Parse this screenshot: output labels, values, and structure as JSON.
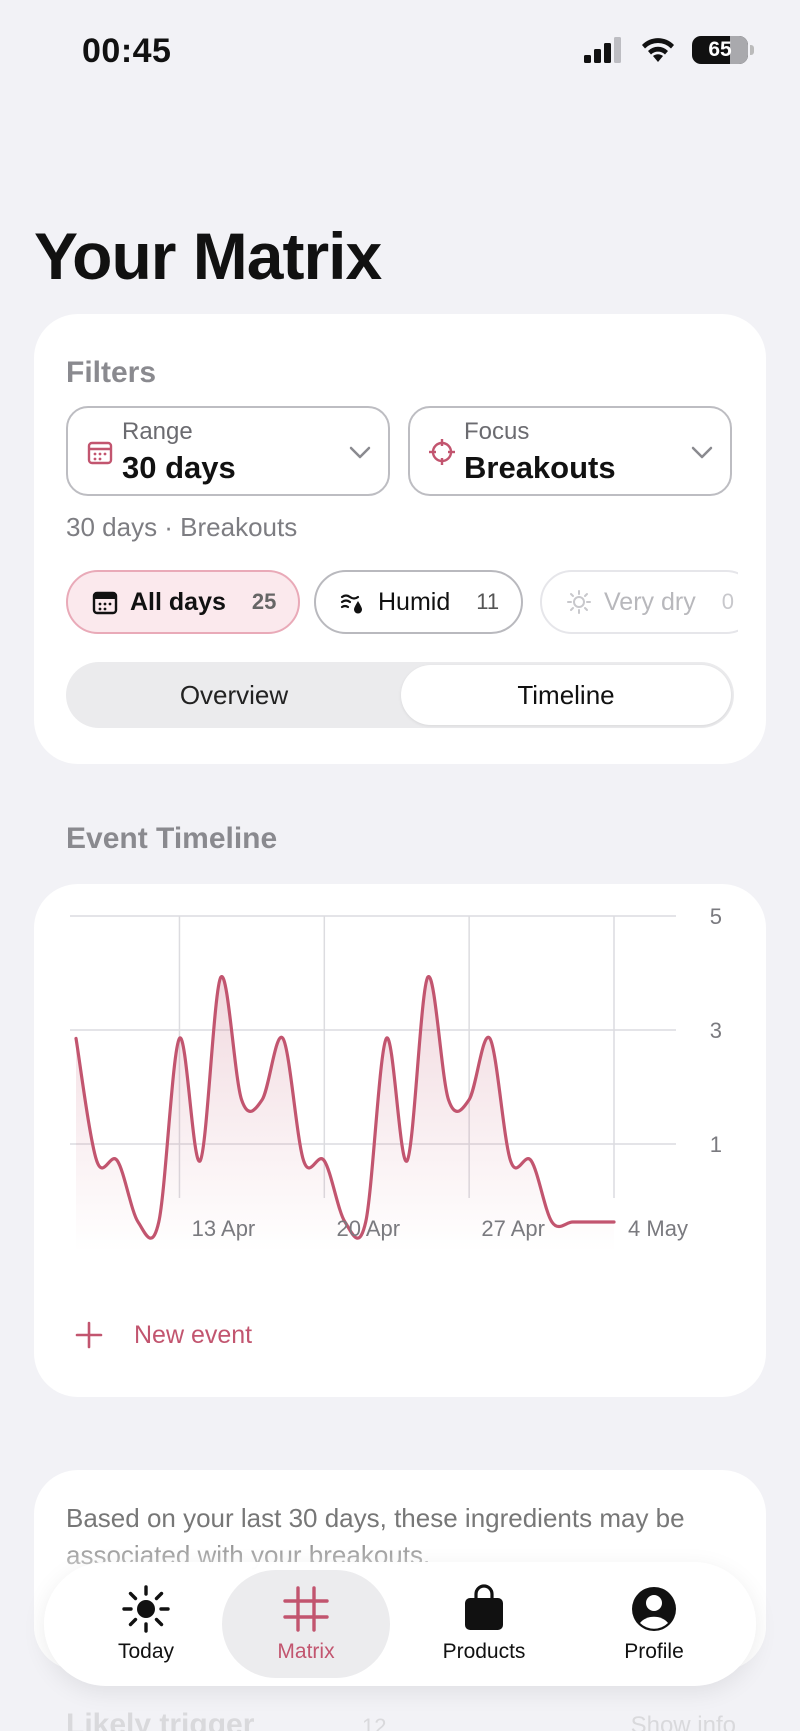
{
  "status": {
    "time": "00:45",
    "battery": "65"
  },
  "page": {
    "title": "Your Matrix"
  },
  "filters": {
    "section_label": "Filters",
    "range": {
      "label": "Range",
      "value": "30 days"
    },
    "focus": {
      "label": "Focus",
      "value": "Breakouts"
    },
    "summary": "30 days · Breakouts",
    "chips": [
      {
        "label": "All days",
        "count": "25",
        "icon": "calendar-icon"
      },
      {
        "label": "Humid",
        "count": "11",
        "icon": "humid-icon"
      },
      {
        "label": "Very dry",
        "count": "0",
        "icon": "sun-icon"
      }
    ],
    "segments": {
      "overview": "Overview",
      "timeline": "Timeline",
      "selected": "Timeline"
    }
  },
  "timeline": {
    "section_label": "Event Timeline",
    "new_event_label": "New event"
  },
  "chart_data": {
    "type": "area",
    "x": [
      "8 Apr",
      "9 Apr",
      "10 Apr",
      "11 Apr",
      "12 Apr",
      "13 Apr",
      "14 Apr",
      "15 Apr",
      "16 Apr",
      "17 Apr",
      "18 Apr",
      "19 Apr",
      "20 Apr",
      "21 Apr",
      "22 Apr",
      "23 Apr",
      "24 Apr",
      "25 Apr",
      "26 Apr",
      "27 Apr",
      "28 Apr",
      "29 Apr",
      "30 Apr",
      "1 May",
      "2 May",
      "3 May",
      "4 May"
    ],
    "series": [
      {
        "values": [
          3,
          1,
          1,
          0,
          0,
          3,
          1,
          4,
          2,
          2,
          3,
          1,
          1,
          0,
          0,
          3,
          1,
          4,
          2,
          2,
          3,
          1,
          1,
          0,
          0,
          0,
          0
        ]
      }
    ],
    "x_ticks": [
      "13 Apr",
      "20 Apr",
      "27 Apr",
      "4 May"
    ],
    "y_ticks": [
      1,
      3,
      5
    ],
    "ylim": [
      0,
      5
    ],
    "grid": true,
    "color": "#c2556f"
  },
  "info": {
    "text": "Based on your last 30 days, these ingredients may be associated with your breakouts."
  },
  "ghost_row": {
    "title": "Likely trigger",
    "count": "12",
    "link": "Show info"
  },
  "tabs": [
    {
      "id": "today",
      "label": "Today",
      "icon": "sun-icon"
    },
    {
      "id": "matrix",
      "label": "Matrix",
      "icon": "grid-hash-icon"
    },
    {
      "id": "products",
      "label": "Products",
      "icon": "bag-icon"
    },
    {
      "id": "profile",
      "label": "Profile",
      "icon": "person-circle-icon"
    }
  ],
  "colors": {
    "accent": "#c2556f",
    "background": "#f2f2f6",
    "card": "#ffffff"
  }
}
